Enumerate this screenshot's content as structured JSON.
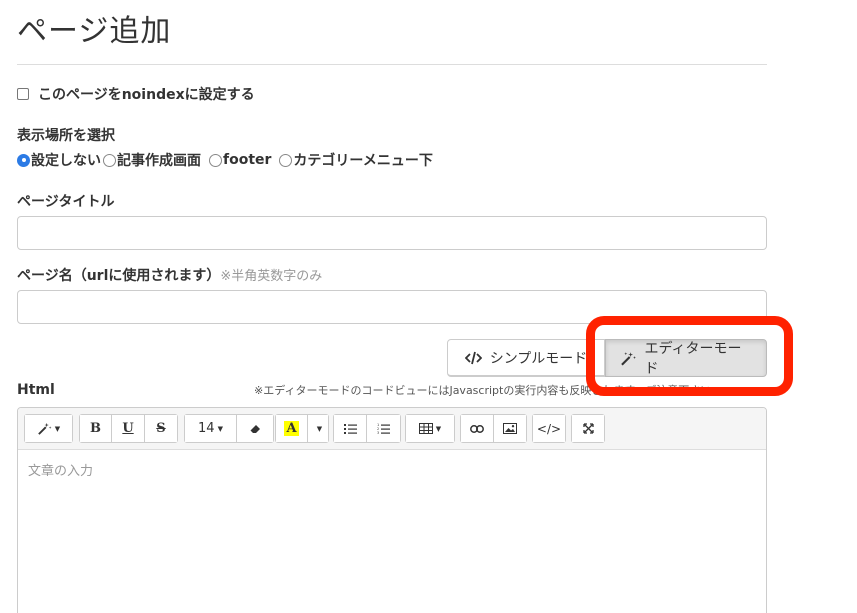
{
  "page": {
    "title": "ページ追加"
  },
  "noindex": {
    "label": "このページをnoindexに設定する",
    "checked": false
  },
  "placement": {
    "label": "表示場所を選択",
    "options": [
      {
        "label": "設定しない",
        "checked": true
      },
      {
        "label": "記事作成画面",
        "checked": false
      },
      {
        "label": "footer",
        "checked": false
      },
      {
        "label": "カテゴリーメニュー下",
        "checked": false
      }
    ]
  },
  "page_title_field": {
    "label": "ページタイトル",
    "value": ""
  },
  "page_name_field": {
    "label": "ページ名（urlに使用されます）",
    "hint": "※半角英数字のみ",
    "value": ""
  },
  "mode": {
    "simple_label": "シンプルモード",
    "editor_label": "エディターモード",
    "active": "editor"
  },
  "html_section": {
    "label": "Html",
    "notice": "※エディターモードのコードビューにはJavascriptの実行内容も反映されます。ご注意下さい"
  },
  "toolbar": {
    "font_size": "14"
  },
  "editor": {
    "placeholder": "文章の入力"
  },
  "colors": {
    "accent": "#2c7be5",
    "highlight": "#ff2200",
    "text_highlight": "#ffff00"
  }
}
